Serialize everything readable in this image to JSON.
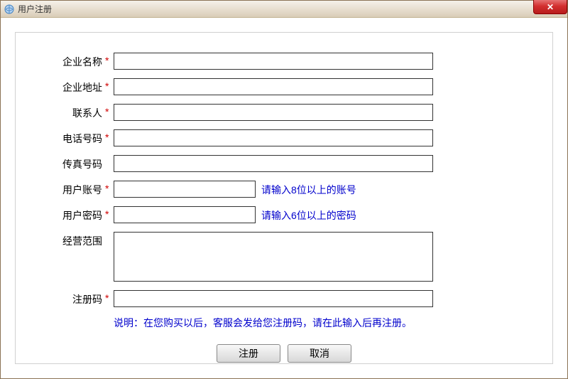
{
  "window": {
    "title": "用户注册"
  },
  "form": {
    "fields": {
      "company_name": {
        "label": "企业名称",
        "required": true,
        "value": ""
      },
      "company_address": {
        "label": "企业地址",
        "required": true,
        "value": ""
      },
      "contact_person": {
        "label": "联系人",
        "required": true,
        "value": ""
      },
      "phone": {
        "label": "电话号码",
        "required": true,
        "value": ""
      },
      "fax": {
        "label": "传真号码",
        "required": false,
        "value": ""
      },
      "username": {
        "label": "用户账号",
        "required": true,
        "value": "",
        "hint": "请输入8位以上的账号"
      },
      "password": {
        "label": "用户密码",
        "required": true,
        "value": "",
        "hint": "请输入6位以上的密码"
      },
      "business_scope": {
        "label": "经营范围",
        "required": false,
        "value": ""
      },
      "reg_code": {
        "label": "注册码",
        "required": true,
        "value": ""
      }
    },
    "required_mark": "*",
    "note": {
      "label": "说明：",
      "text": "在您购买以后，客服会发给您注册码，请在此输入后再注册。"
    },
    "buttons": {
      "register": "注册",
      "cancel": "取消"
    }
  }
}
